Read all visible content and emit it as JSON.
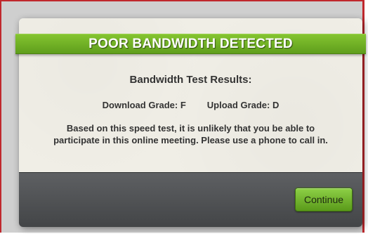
{
  "dialog": {
    "banner_title": "POOR BANDWIDTH DETECTED",
    "results_heading": "Bandwidth Test Results:",
    "download_grade": "Download Grade: F",
    "upload_grade": "Upload Grade: D",
    "message_line1": "Based on this speed test, it is unlikely that you be able to",
    "message_line2": "participate in this online meeting.  Please use a phone to call in.",
    "continue_label": "Continue"
  },
  "colors": {
    "banner": "#6fb025",
    "footer": "#4f5154",
    "paper": "#f0eee6",
    "frame_border": "#c0282d"
  }
}
